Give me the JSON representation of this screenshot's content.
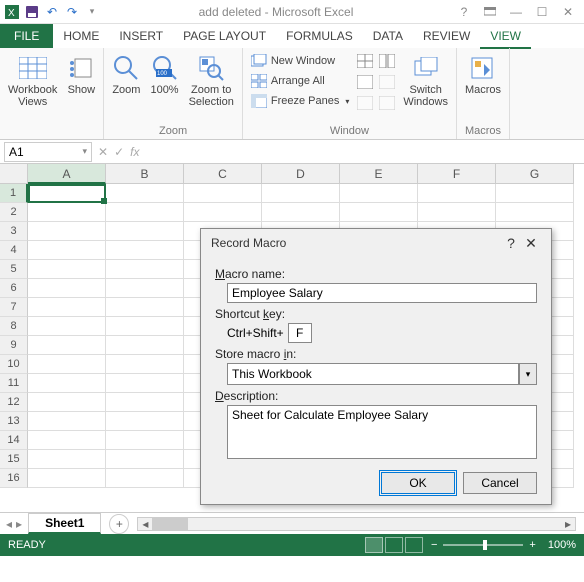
{
  "title": "add deleted - Microsoft Excel",
  "tabs": {
    "file": "FILE",
    "list": [
      "HOME",
      "INSERT",
      "PAGE LAYOUT",
      "FORMULAS",
      "DATA",
      "REVIEW",
      "VIEW"
    ],
    "active": "VIEW"
  },
  "ribbon": {
    "views": {
      "workbook": "Workbook\nViews",
      "show": "Show"
    },
    "zoom": {
      "zoom": "Zoom",
      "hundred": "100%",
      "selection": "Zoom to\nSelection",
      "group": "Zoom"
    },
    "window": {
      "new": "New Window",
      "arrange": "Arrange All",
      "freeze": "Freeze Panes",
      "switch": "Switch\nWindows",
      "group": "Window"
    },
    "macros": {
      "btn": "Macros",
      "group": "Macros"
    }
  },
  "namebox": "A1",
  "columns": [
    "A",
    "B",
    "C",
    "D",
    "E",
    "F",
    "G"
  ],
  "rows_count": 16,
  "sheet": {
    "name": "Sheet1"
  },
  "status": {
    "ready": "READY",
    "zoom": "100%"
  },
  "dialog": {
    "title": "Record Macro",
    "macro_name_label": "Macro name:",
    "macro_name": "Employee Salary",
    "shortcut_label": "Shortcut key:",
    "shortcut_prefix": "Ctrl+Shift+",
    "shortcut_key": "F",
    "store_label": "Store macro in:",
    "store_value": "This Workbook",
    "description_label": "Description:",
    "description": "Sheet for Calculate Employee Salary",
    "ok": "OK",
    "cancel": "Cancel"
  }
}
